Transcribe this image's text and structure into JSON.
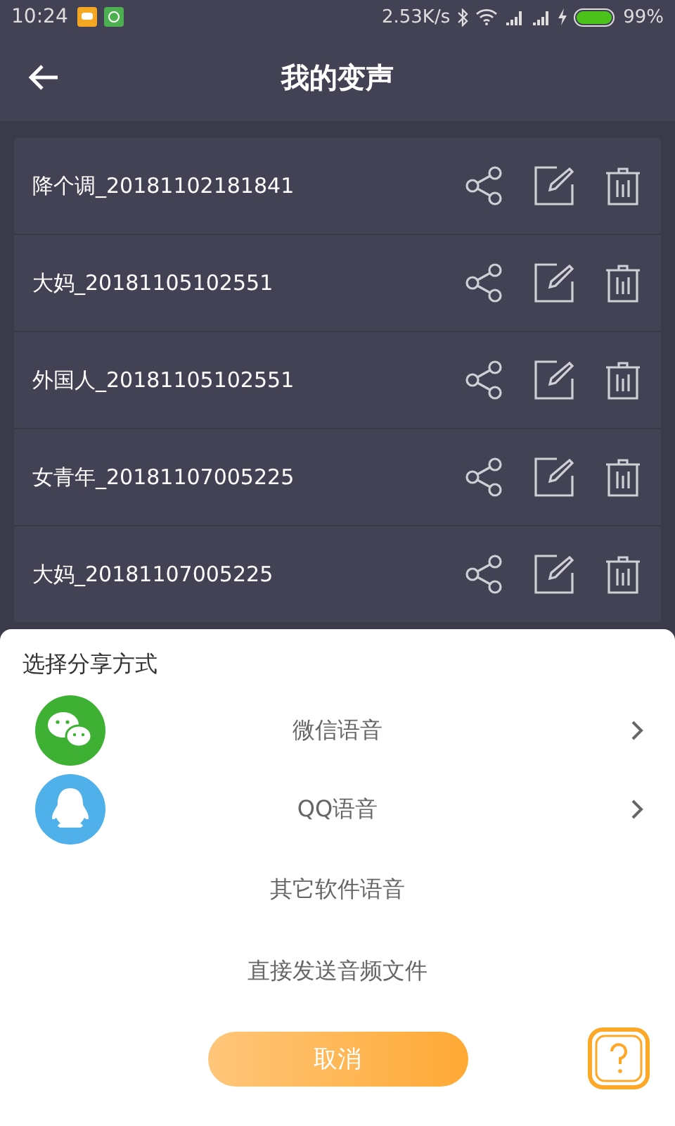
{
  "status_bar": {
    "time": "10:24",
    "speed": "2.53K/s",
    "battery": "99%"
  },
  "header": {
    "title": "我的变声"
  },
  "recordings": [
    {
      "name": "降个调_20181102181841"
    },
    {
      "name": "大妈_20181105102551"
    },
    {
      "name": "外国人_20181105102551"
    },
    {
      "name": "女青年_20181107005225"
    },
    {
      "name": "大妈_20181107005225"
    }
  ],
  "share_sheet": {
    "title": "选择分享方式",
    "options": [
      {
        "kind": "wechat",
        "label": "微信语音"
      },
      {
        "kind": "qq",
        "label": "QQ语音"
      },
      {
        "kind": "plain",
        "label": "其它软件语音"
      },
      {
        "kind": "plain",
        "label": "直接发送音频文件"
      }
    ],
    "cancel": "取消"
  }
}
